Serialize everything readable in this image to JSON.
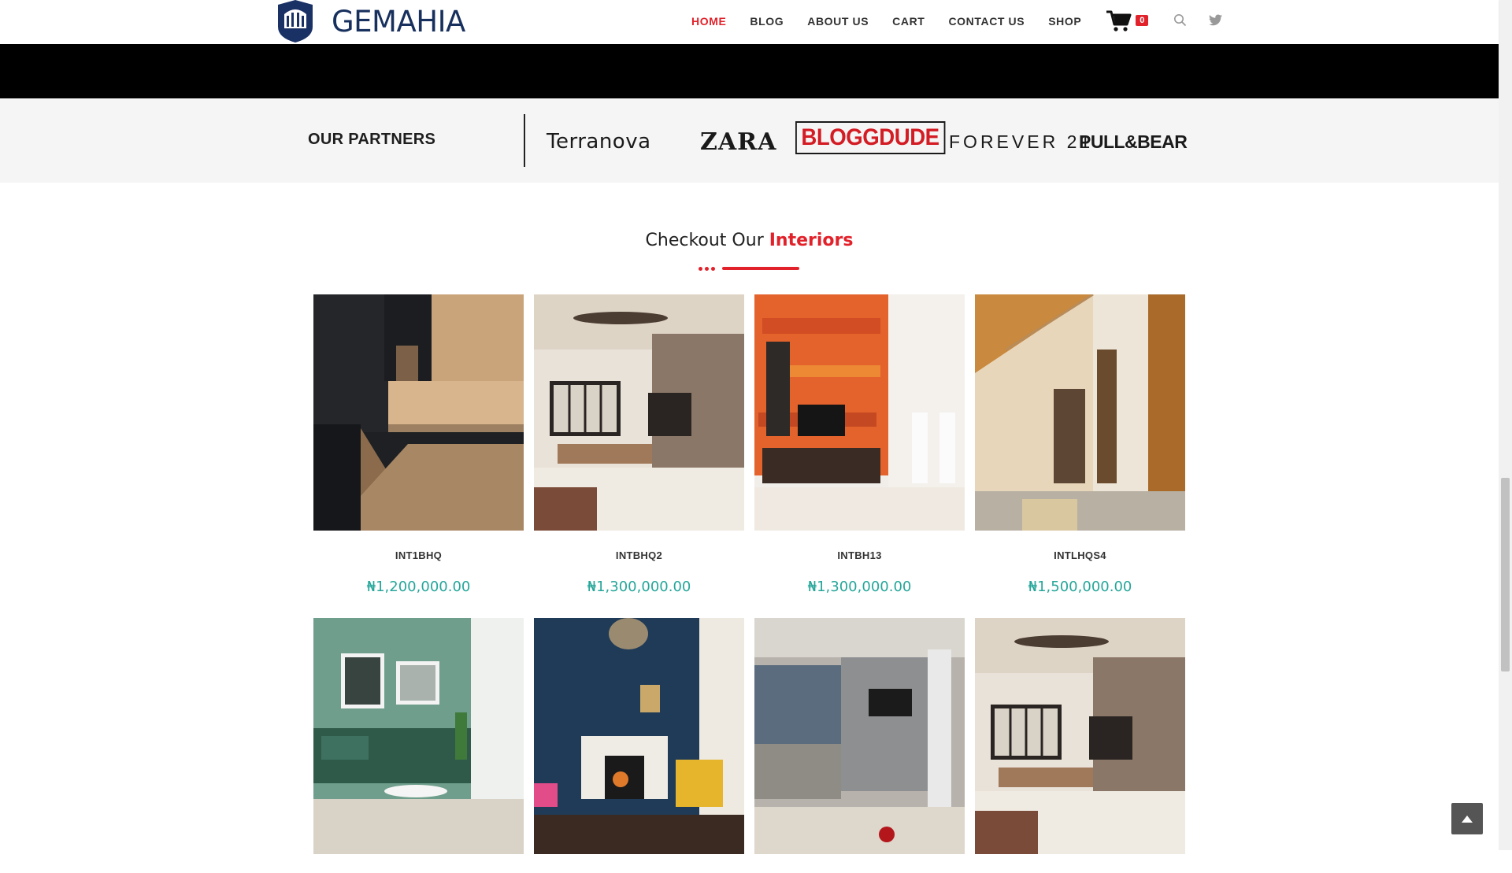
{
  "header": {
    "logo_text": "GEMAHIA",
    "nav": [
      {
        "label": "HOME",
        "active": true
      },
      {
        "label": "BLOG"
      },
      {
        "label": "ABOUT US"
      },
      {
        "label": "CART"
      },
      {
        "label": "CONTACT US"
      },
      {
        "label": "SHOP"
      }
    ],
    "cart_count": "0",
    "icons": [
      "logo-icon",
      "cart-icon",
      "search-icon",
      "twitter-icon"
    ]
  },
  "partners": {
    "title": "OUR PARTNERS",
    "brands": [
      "Terranova",
      "ZARA",
      "BLOGGDUDE",
      "FOREVER 21",
      "PULL&BEAR"
    ]
  },
  "section": {
    "title_prefix": "Checkout Our",
    "title_accent": "Interiors"
  },
  "products": [
    {
      "name": "INT1BHQ",
      "price": "₦1,200,000.00"
    },
    {
      "name": "INTBHQ2",
      "price": "₦1,300,000.00"
    },
    {
      "name": "INTBH13",
      "price": "₦1,300,000.00"
    },
    {
      "name": "INTLHQS4",
      "price": "₦1,500,000.00"
    },
    {
      "name": "",
      "price": ""
    },
    {
      "name": "",
      "price": ""
    },
    {
      "name": "",
      "price": ""
    },
    {
      "name": "",
      "price": ""
    }
  ],
  "colors": {
    "accent": "#e2222b",
    "price": "#26a69a",
    "brand_navy": "#18305e"
  }
}
